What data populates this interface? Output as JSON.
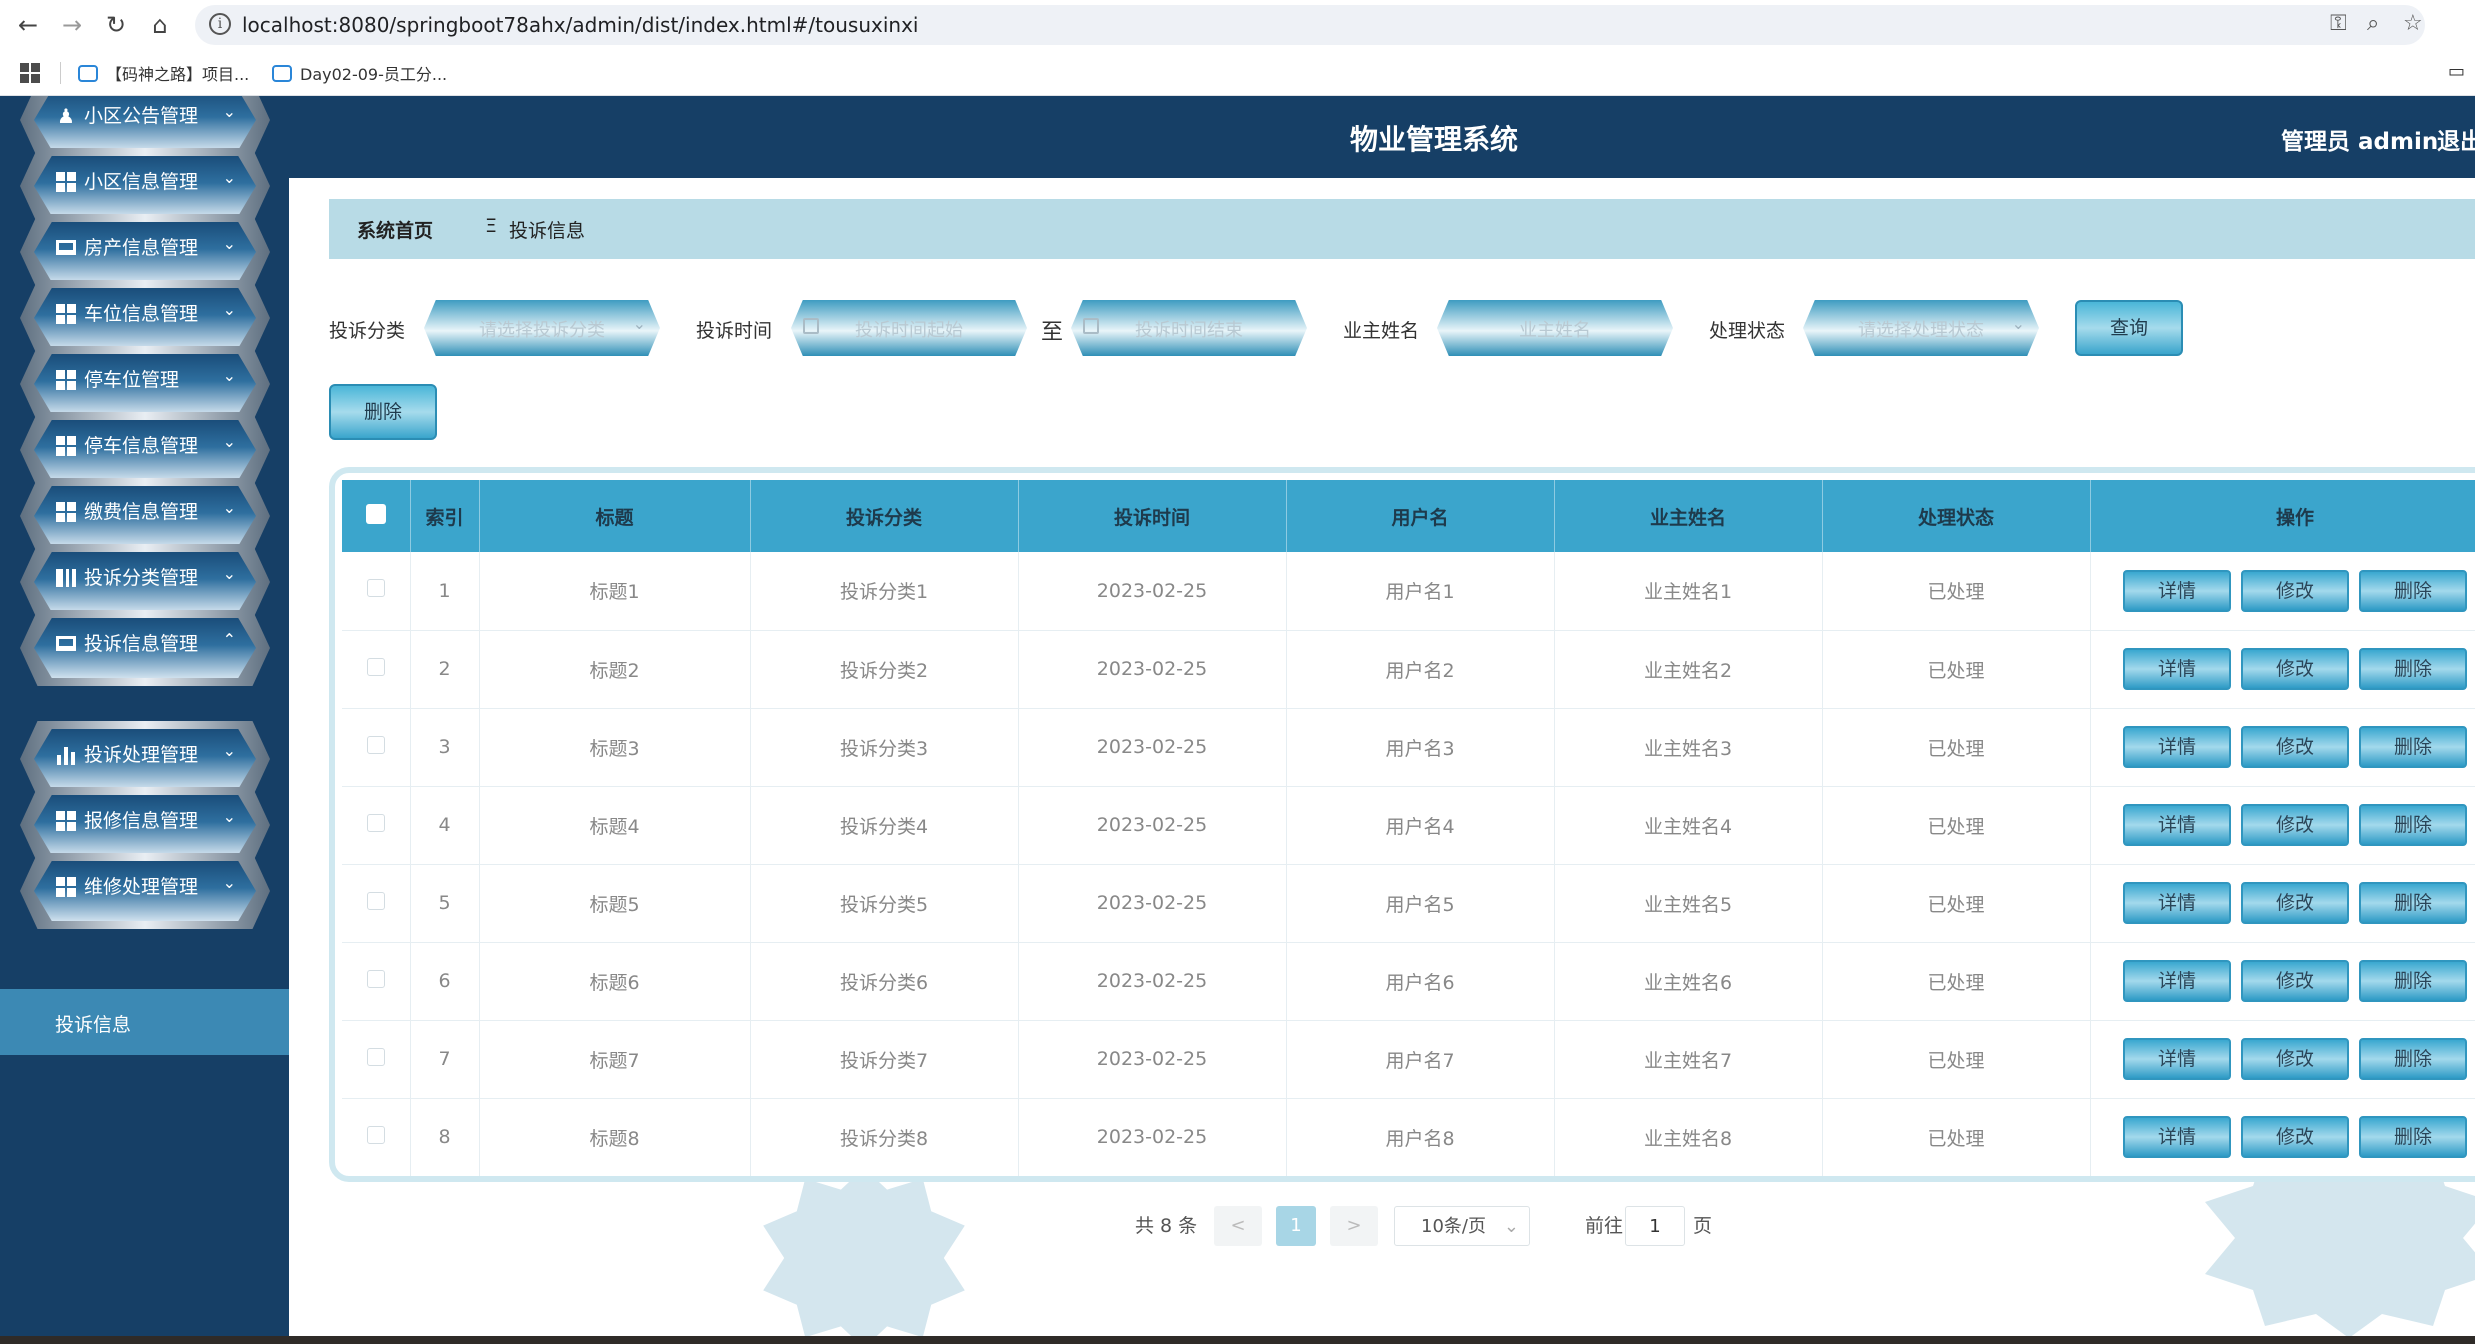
{
  "browser": {
    "url": "localhost:8080/springboot78ahx/admin/dist/index.html#/tousuxinxi",
    "bookmarks": [
      "【码神之路】项目...",
      "Day02-09-员工分..."
    ]
  },
  "header": {
    "title": "物业管理系统",
    "admin": "管理员 admin",
    "logout": "退出"
  },
  "sidebar": {
    "items": [
      {
        "label": "小区公告管理",
        "icon": "user-icon"
      },
      {
        "label": "小区信息管理",
        "icon": "grid-icon"
      },
      {
        "label": "房产信息管理",
        "icon": "monitor-icon"
      },
      {
        "label": "车位信息管理",
        "icon": "grid-icon"
      },
      {
        "label": "停车位管理",
        "icon": "grid-icon"
      },
      {
        "label": "停车信息管理",
        "icon": "grid-icon"
      },
      {
        "label": "缴费信息管理",
        "icon": "grid-icon"
      },
      {
        "label": "投诉分类管理",
        "icon": "book-icon"
      },
      {
        "label": "投诉信息管理",
        "icon": "monitor-icon",
        "expanded": true
      },
      {
        "label": "投诉处理管理",
        "icon": "bar-chart-icon"
      },
      {
        "label": "报修信息管理",
        "icon": "grid-icon"
      },
      {
        "label": "维修处理管理",
        "icon": "grid-icon"
      }
    ],
    "subitem": "投诉信息"
  },
  "breadcrumb": {
    "home": "系统首页",
    "separator": "Ξ",
    "current": "投诉信息"
  },
  "filters": {
    "category_label": "投诉分类",
    "category_placeholder": "请选择投诉分类",
    "time_label": "投诉时间",
    "time_start_placeholder": "投诉时间起始",
    "to": "至",
    "time_end_placeholder": "投诉时间结束",
    "owner_label": "业主姓名",
    "owner_placeholder": "业主姓名",
    "status_label": "处理状态",
    "status_placeholder": "请选择处理状态",
    "query_button": "查询",
    "delete_button": "删除"
  },
  "table": {
    "columns": [
      "索引",
      "标题",
      "投诉分类",
      "投诉时间",
      "用户名",
      "业主姓名",
      "处理状态",
      "操作"
    ],
    "rows": [
      [
        "1",
        "标题1",
        "投诉分类1",
        "2023-02-25",
        "用户名1",
        "业主姓名1",
        "已处理"
      ],
      [
        "2",
        "标题2",
        "投诉分类2",
        "2023-02-25",
        "用户名2",
        "业主姓名2",
        "已处理"
      ],
      [
        "3",
        "标题3",
        "投诉分类3",
        "2023-02-25",
        "用户名3",
        "业主姓名3",
        "已处理"
      ],
      [
        "4",
        "标题4",
        "投诉分类4",
        "2023-02-25",
        "用户名4",
        "业主姓名4",
        "已处理"
      ],
      [
        "5",
        "标题5",
        "投诉分类5",
        "2023-02-25",
        "用户名5",
        "业主姓名5",
        "已处理"
      ],
      [
        "6",
        "标题6",
        "投诉分类6",
        "2023-02-25",
        "用户名6",
        "业主姓名6",
        "已处理"
      ],
      [
        "7",
        "标题7",
        "投诉分类7",
        "2023-02-25",
        "用户名7",
        "业主姓名7",
        "已处理"
      ],
      [
        "8",
        "标题8",
        "投诉分类8",
        "2023-02-25",
        "用户名8",
        "业主姓名8",
        "已处理"
      ]
    ],
    "actions": [
      "详情",
      "修改",
      "删除"
    ]
  },
  "pagination": {
    "total": "共 8 条",
    "prev": "<",
    "current_page": "1",
    "next": ">",
    "page_size": "10条/页",
    "goto_label": "前往",
    "goto_value": "1",
    "page_suffix": "页"
  },
  "colors": {
    "nav_dark": "#163f66",
    "accent": "#3ba5cc",
    "breadcrumb_bg": "#b8dbe6",
    "active_submenu": "#3c89b4"
  }
}
